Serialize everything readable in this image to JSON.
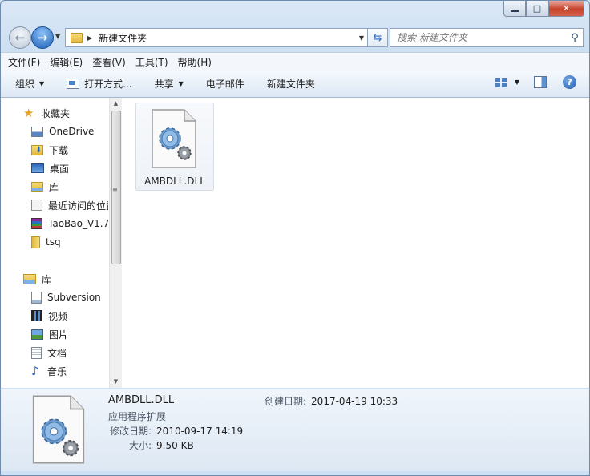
{
  "window": {
    "min": "0",
    "max": "□",
    "close": "✕"
  },
  "address": {
    "path": "新建文件夹"
  },
  "search": {
    "placeholder": "搜索 新建文件夹"
  },
  "menu": [
    "文件(F)",
    "编辑(E)",
    "查看(V)",
    "工具(T)",
    "帮助(H)"
  ],
  "toolbar": {
    "organize": "组织",
    "open_with": "打开方式...",
    "share": "共享",
    "email": "电子邮件",
    "new_folder": "新建文件夹"
  },
  "nav": {
    "favorites": "收藏夹",
    "fav_items": [
      "OneDrive",
      "下载",
      "桌面",
      "库",
      "最近访问的位置",
      "TaoBao_V1.7",
      "tsq"
    ],
    "libraries": "库",
    "lib_items": [
      "Subversion",
      "视频",
      "图片",
      "文档",
      "音乐"
    ]
  },
  "file": {
    "name": "AMBDLL.DLL",
    "icon": "dll-settings-icon"
  },
  "details": {
    "name": "AMBDLL.DLL",
    "type": "应用程序扩展",
    "modified_label": "修改日期:",
    "modified": "2010-09-17 14:19",
    "size_label": "大小:",
    "size": "9.50 KB",
    "created_label": "创建日期:",
    "created": "2017-04-19 10:33"
  }
}
